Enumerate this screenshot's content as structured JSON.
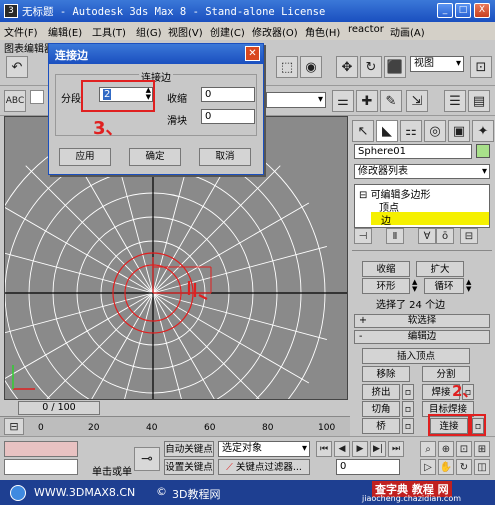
{
  "window": {
    "title": "无标题  - Autodesk 3ds Max 8  - Stand-alone License",
    "min": "_",
    "max": "□",
    "close": "X"
  },
  "menu": [
    "文件(F)",
    "编辑(E)",
    "工具(T)",
    "组(G)",
    "视图(V)",
    "创建(C)",
    "修改器(O)",
    "角色(H)",
    "reactor",
    "动画(A)"
  ],
  "menu_row2": "图表编辑器",
  "toolbar": {
    "view_select": "视图"
  },
  "dialog": {
    "title": "连接边",
    "group_label": "连接边",
    "segments_label": "分段",
    "segments_value": "2",
    "pinch_label": "收缩",
    "pinch_value": "0",
    "slide_label": "滑块",
    "slide_value": "0",
    "apply": "应用",
    "ok": "确定",
    "cancel": "取消"
  },
  "panel": {
    "object_name": "Sphere01",
    "modifier_list": "修改器列表",
    "stack": [
      "可编辑多边形",
      "顶点",
      "边"
    ],
    "grow": "扩大",
    "shrink": "收缩",
    "ring": "环形",
    "loop": "循环",
    "selected_info": "选择了 24 个边",
    "soft_selection": "软选择",
    "edit_edges": "编辑边",
    "insert_vertex": "插入顶点",
    "remove": "移除",
    "split": "分割",
    "extrude": "挤出",
    "weld": "焊接",
    "chamfer": "切角",
    "target_weld": "目标焊接",
    "bridge": "桥",
    "connect": "连接"
  },
  "timeline": {
    "frame": "0 / 100"
  },
  "ticks": [
    "0",
    "20",
    "40",
    "60",
    "80",
    "100"
  ],
  "status": {
    "single": "单击或单",
    "auto_key": "自动关键点",
    "set_key": "设置关键点",
    "selected_object": "选定对象",
    "key_filter": "关键点过滤器...",
    "frame_value": "0"
  },
  "annotations": {
    "step2": "2、",
    "step3": "3、"
  },
  "footer": {
    "site1": "WWW.3DMAX8.CN",
    "site2": "3D教程网",
    "watermark1": "查字典 教程 网",
    "watermark2": "jiaocheng.chazidian.com"
  },
  "colors": {
    "title_blue": "#1a4fbf",
    "highlight_yellow": "#f5f000",
    "annotation_red": "#e02020",
    "viewport_grey": "#8a8a8a"
  }
}
